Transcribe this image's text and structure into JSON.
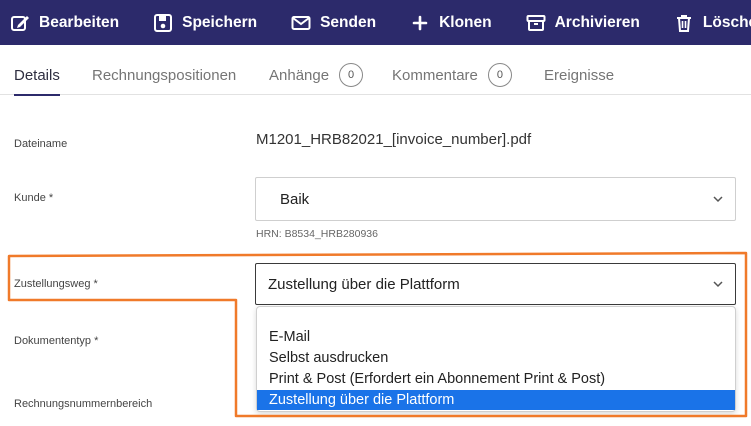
{
  "toolbar": {
    "edit_label": "Bearbeiten",
    "save_label": "Speichern",
    "send_label": "Senden",
    "clone_label": "Klonen",
    "archive_label": "Archivieren",
    "delete_label": "Löschen"
  },
  "tabs": [
    {
      "label": "Details",
      "active": true
    },
    {
      "label": "Rechnungspositionen"
    },
    {
      "label": "Anhänge",
      "count": "0"
    },
    {
      "label": "Kommentare",
      "count": "0"
    },
    {
      "label": "Ereignisse"
    }
  ],
  "form": {
    "filename_label": "Dateiname",
    "filename_value": "M1201_HRB82021_[invoice_number].pdf",
    "customer_label": "Kunde *",
    "customer_value": "Baik",
    "customer_hint": "HRN: B8534_HRB280936",
    "delivery_label": "Zustellungsweg *",
    "delivery_value": "Zustellung über die Plattform",
    "doctype_label": "Dokumententyp *",
    "numberrange_label": "Rechnungsnummernbereich"
  },
  "delivery_options": [
    {
      "label": "E-Mail"
    },
    {
      "label": "Selbst ausdrucken"
    },
    {
      "label": "Print & Post (Erfordert ein Abonnement Print & Post)"
    },
    {
      "label": "Zustellung über die Plattform",
      "selected": true
    }
  ],
  "colors": {
    "toolbar_bg": "#2c2a6b",
    "highlight_outline": "#f07a2a",
    "selected_option": "#1a73e8"
  }
}
